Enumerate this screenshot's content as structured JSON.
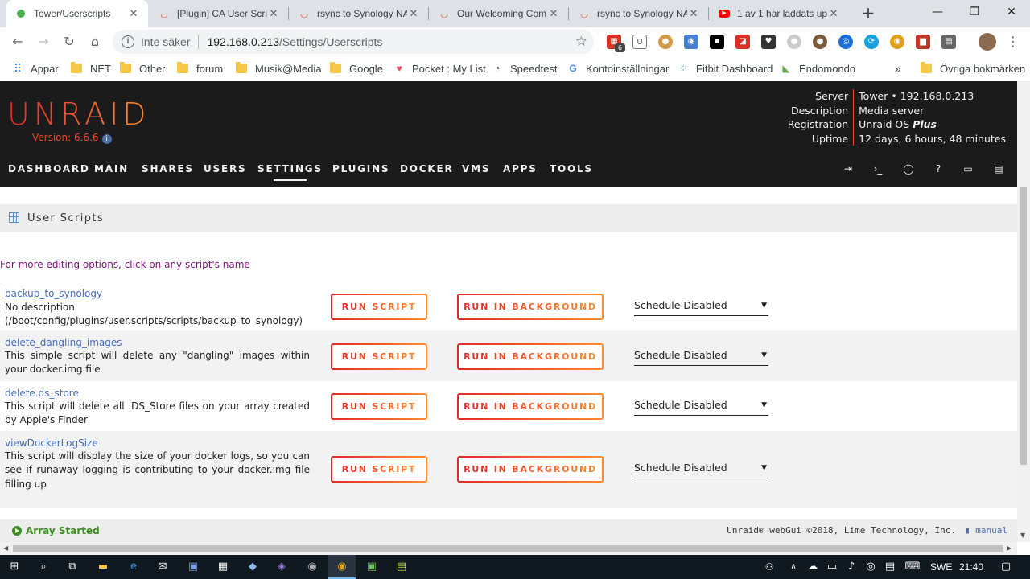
{
  "browser": {
    "tabs": [
      {
        "title": "Tower/Userscripts",
        "active": true
      },
      {
        "title": "[Plugin] CA User Scrip",
        "active": false
      },
      {
        "title": "rsync to Synology NA",
        "active": false
      },
      {
        "title": "Our Welcoming Comm",
        "active": false
      },
      {
        "title": "rsync to Synology NA",
        "active": false
      },
      {
        "title": "1 av 1 har laddats up",
        "active": false
      }
    ],
    "address": {
      "security_label": "Inte säker",
      "host": "192.168.0.213",
      "path": "/Settings/Userscripts"
    },
    "extension_badge": "6",
    "bookmarks": [
      {
        "label": "Appar",
        "icon": "apps-grid-icon"
      },
      {
        "label": "NET",
        "icon": "folder-icon"
      },
      {
        "label": "Other",
        "icon": "folder-icon"
      },
      {
        "label": "forum",
        "icon": "folder-icon"
      },
      {
        "label": "Musik@Media",
        "icon": "folder-icon"
      },
      {
        "label": "Google",
        "icon": "folder-icon"
      },
      {
        "label": "Pocket : My List",
        "icon": "pocket-icon"
      },
      {
        "label": "Speedtest",
        "icon": "speedtest-icon"
      },
      {
        "label": "Kontoinställningar",
        "icon": "google-icon"
      },
      {
        "label": "Fitbit Dashboard",
        "icon": "fitbit-icon"
      },
      {
        "label": "Endomondo",
        "icon": "endomondo-icon"
      }
    ],
    "bookmarks_overflow": "»",
    "other_bookmarks": "Övriga bokmärken"
  },
  "unraid": {
    "logo": "UNRAID",
    "version": "Version: 6.6.6",
    "server_info": [
      {
        "key": "Server",
        "value": "Tower • 192.168.0.213"
      },
      {
        "key": "Description",
        "value": "Media server"
      },
      {
        "key": "Registration",
        "value": "Unraid OS",
        "emph": "Plus"
      },
      {
        "key": "Uptime",
        "value": "12 days, 6 hours, 48 minutes"
      }
    ],
    "nav": [
      "DASHBOARD",
      "MAIN",
      "SHARES",
      "USERS",
      "SETTINGS",
      "PLUGINS",
      "DOCKER",
      "VMS",
      "APPS",
      "TOOLS"
    ],
    "active_nav": "SETTINGS"
  },
  "page": {
    "title": "User Scripts",
    "hint": "For more editing options, click on any script's name",
    "run_label": "RUN SCRIPT",
    "background_label": "RUN IN BACKGROUND",
    "scripts": [
      {
        "name": "backup_to_synology",
        "description": "No description\n(/boot/config/plugins/user.scripts/scripts/backup_to_synology)",
        "schedule": "Schedule Disabled"
      },
      {
        "name": "delete_dangling_images",
        "description": "This simple script will delete any \"dangling\" images within your docker.img file",
        "schedule": "Schedule Disabled"
      },
      {
        "name": "delete.ds_store",
        "description": "This script will delete all .DS_Store files on your array created by Apple's Finder",
        "schedule": "Schedule Disabled"
      },
      {
        "name": "viewDockerLogSize",
        "description": "This script will display the size of your docker logs, so you can see if runaway logging is contributing to your docker.img file filling up",
        "schedule": "Schedule Disabled"
      }
    ]
  },
  "footer": {
    "status": "Array Started",
    "copyright": "Unraid® webGui ©2018, Lime Technology, Inc.",
    "manual": "manual"
  },
  "taskbar": {
    "language": "SWE",
    "time": "21:40"
  },
  "colors": {
    "accent_start": "#e22828",
    "accent_end": "#ff8c2f",
    "header_bg": "#1c1b1b",
    "link": "#486dba",
    "status_green": "#3c8d1f"
  }
}
